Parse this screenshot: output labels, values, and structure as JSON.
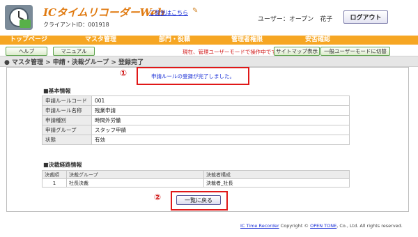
{
  "header": {
    "app_title": "ICタイムリコーダーWeb",
    "client_id": "クライアントID：001918",
    "opinion_link": "ご意見はこちら",
    "user_info": "ユーザー：オープン　花子",
    "logout": "ログアウト"
  },
  "menu": [
    "トップページ",
    "マスタ管理",
    "部門・役職",
    "管理者権限",
    "安否確認"
  ],
  "subbar": {
    "help": "ヘルプ",
    "manual": "マニュアル",
    "mode_text": "現在、管理ユーザーモードで操作中です。",
    "sitemap": "サイトマップ表示",
    "switch_mode": "一般ユーザーモードに切替"
  },
  "breadcrumb": "● マスタ管理 > 申請・決裁グループ > 登録完了",
  "markers": {
    "one": "①",
    "two": "②"
  },
  "message": "申請ルールの登録が完了しました。",
  "basic_info": {
    "title": "■基本情報",
    "rows": [
      {
        "label": "申請ルールコード",
        "value": "001"
      },
      {
        "label": "申請ルール名称",
        "value": "残業申請"
      },
      {
        "label": "申請種別",
        "value": "時間外労働"
      },
      {
        "label": "申請グループ",
        "value": "スタッフ申請"
      },
      {
        "label": "状態",
        "value": "有効"
      }
    ]
  },
  "route_info": {
    "title": "■決裁経路情報",
    "headers": [
      "決裁順",
      "決裁グループ",
      "決裁者構成"
    ],
    "rows": [
      {
        "order": "1",
        "group": "社長決裁",
        "composition": "決裁者_社長"
      }
    ]
  },
  "back_button": "一覧に戻る",
  "footer": {
    "product_link": "IC Time Recorder",
    "copyright": " Copyright © ",
    "company_link": "OPEN TONE",
    "rights": ", Co., Ltd. All rights reserved."
  },
  "colors": {
    "accent": "#f6a623",
    "alert": "#e01818",
    "link": "#1a2fd6"
  }
}
